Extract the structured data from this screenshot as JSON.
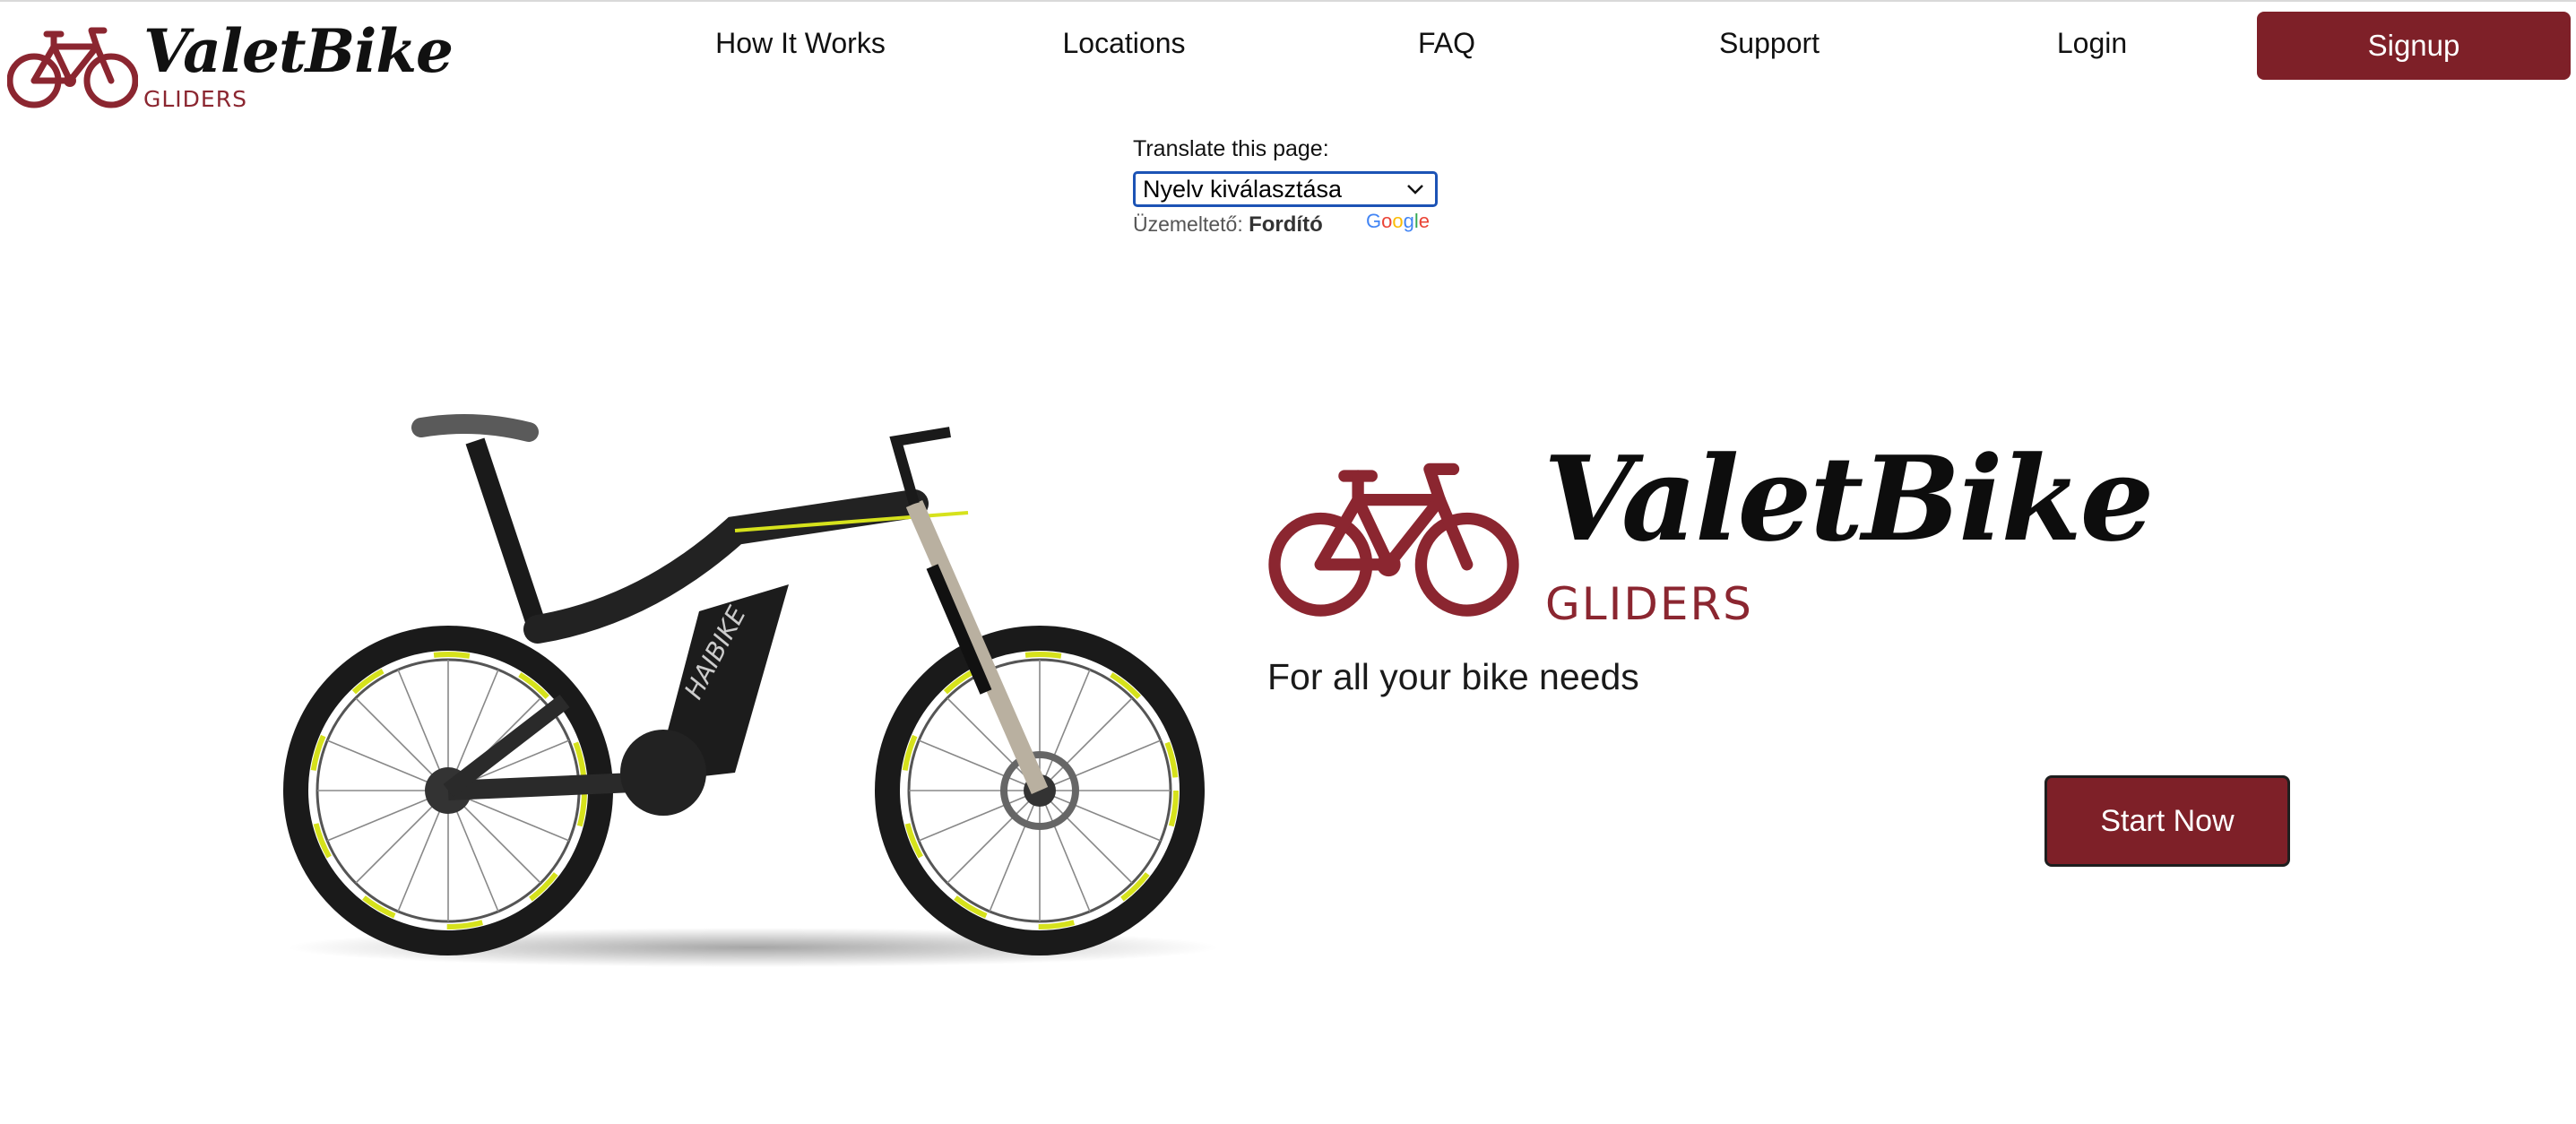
{
  "header": {
    "brand_name": "ValetBike",
    "brand_sub": "GLIDERS",
    "nav": [
      {
        "label": "How It Works"
      },
      {
        "label": "Locations"
      },
      {
        "label": "FAQ"
      },
      {
        "label": "Support"
      },
      {
        "label": "Login"
      }
    ],
    "signup_label": "Signup"
  },
  "translate": {
    "label": "Translate this page:",
    "selected_value": "Nyelv kiválasztása",
    "powered_prefix": "Üzemeltető:",
    "powered_product": "Fordító",
    "google_wordmark": "Google"
  },
  "hero": {
    "brand_name": "ValetBike",
    "brand_sub": "GLIDERS",
    "tagline": "For all your bike needs",
    "start_label": "Start Now",
    "bike_brand_text": "HAIBIKE",
    "bike_icon": "bicycle-icon"
  },
  "colors": {
    "accent": "#7e2028",
    "logo_red": "#8b2630",
    "select_border": "#1c53b5",
    "bike_lime": "#d6e21c"
  }
}
